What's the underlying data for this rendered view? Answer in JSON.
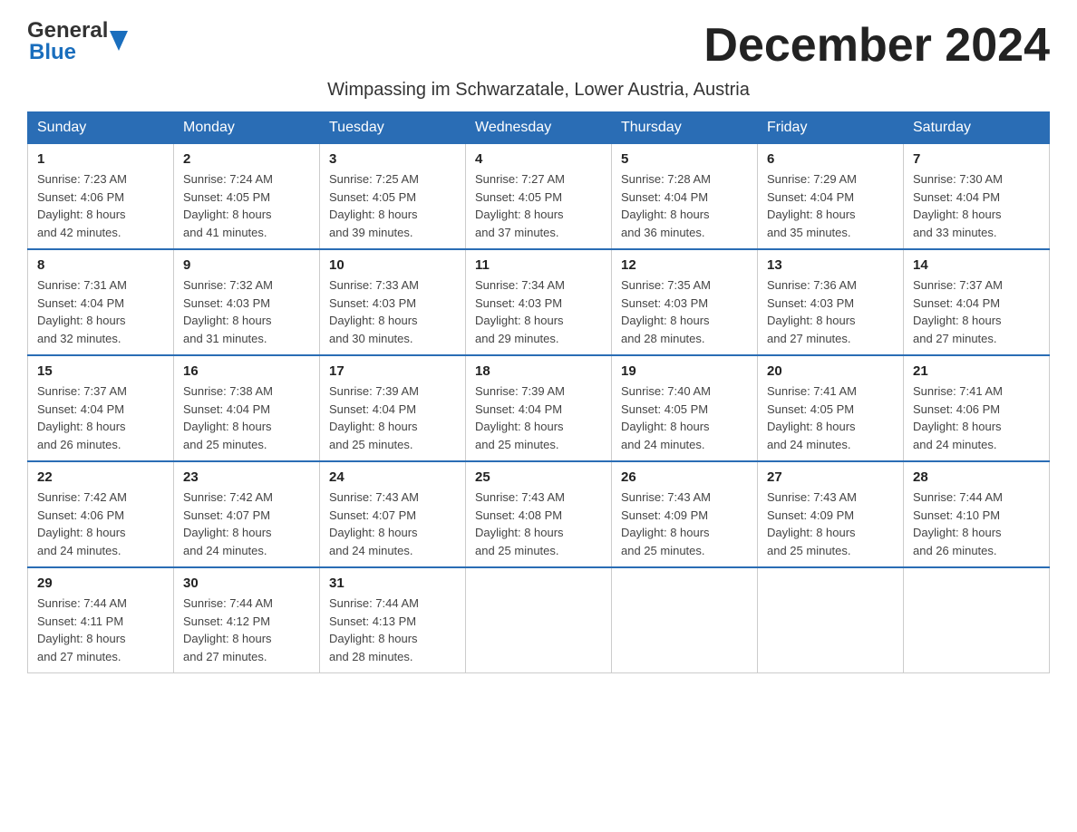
{
  "header": {
    "logo_general": "General",
    "logo_blue": "Blue",
    "month_title": "December 2024",
    "subtitle": "Wimpassing im Schwarzatale, Lower Austria, Austria"
  },
  "days_of_week": [
    "Sunday",
    "Monday",
    "Tuesday",
    "Wednesday",
    "Thursday",
    "Friday",
    "Saturday"
  ],
  "weeks": [
    [
      {
        "day": "1",
        "sunrise": "Sunrise: 7:23 AM",
        "sunset": "Sunset: 4:06 PM",
        "daylight": "Daylight: 8 hours",
        "daylight2": "and 42 minutes."
      },
      {
        "day": "2",
        "sunrise": "Sunrise: 7:24 AM",
        "sunset": "Sunset: 4:05 PM",
        "daylight": "Daylight: 8 hours",
        "daylight2": "and 41 minutes."
      },
      {
        "day": "3",
        "sunrise": "Sunrise: 7:25 AM",
        "sunset": "Sunset: 4:05 PM",
        "daylight": "Daylight: 8 hours",
        "daylight2": "and 39 minutes."
      },
      {
        "day": "4",
        "sunrise": "Sunrise: 7:27 AM",
        "sunset": "Sunset: 4:05 PM",
        "daylight": "Daylight: 8 hours",
        "daylight2": "and 37 minutes."
      },
      {
        "day": "5",
        "sunrise": "Sunrise: 7:28 AM",
        "sunset": "Sunset: 4:04 PM",
        "daylight": "Daylight: 8 hours",
        "daylight2": "and 36 minutes."
      },
      {
        "day": "6",
        "sunrise": "Sunrise: 7:29 AM",
        "sunset": "Sunset: 4:04 PM",
        "daylight": "Daylight: 8 hours",
        "daylight2": "and 35 minutes."
      },
      {
        "day": "7",
        "sunrise": "Sunrise: 7:30 AM",
        "sunset": "Sunset: 4:04 PM",
        "daylight": "Daylight: 8 hours",
        "daylight2": "and 33 minutes."
      }
    ],
    [
      {
        "day": "8",
        "sunrise": "Sunrise: 7:31 AM",
        "sunset": "Sunset: 4:04 PM",
        "daylight": "Daylight: 8 hours",
        "daylight2": "and 32 minutes."
      },
      {
        "day": "9",
        "sunrise": "Sunrise: 7:32 AM",
        "sunset": "Sunset: 4:03 PM",
        "daylight": "Daylight: 8 hours",
        "daylight2": "and 31 minutes."
      },
      {
        "day": "10",
        "sunrise": "Sunrise: 7:33 AM",
        "sunset": "Sunset: 4:03 PM",
        "daylight": "Daylight: 8 hours",
        "daylight2": "and 30 minutes."
      },
      {
        "day": "11",
        "sunrise": "Sunrise: 7:34 AM",
        "sunset": "Sunset: 4:03 PM",
        "daylight": "Daylight: 8 hours",
        "daylight2": "and 29 minutes."
      },
      {
        "day": "12",
        "sunrise": "Sunrise: 7:35 AM",
        "sunset": "Sunset: 4:03 PM",
        "daylight": "Daylight: 8 hours",
        "daylight2": "and 28 minutes."
      },
      {
        "day": "13",
        "sunrise": "Sunrise: 7:36 AM",
        "sunset": "Sunset: 4:03 PM",
        "daylight": "Daylight: 8 hours",
        "daylight2": "and 27 minutes."
      },
      {
        "day": "14",
        "sunrise": "Sunrise: 7:37 AM",
        "sunset": "Sunset: 4:04 PM",
        "daylight": "Daylight: 8 hours",
        "daylight2": "and 27 minutes."
      }
    ],
    [
      {
        "day": "15",
        "sunrise": "Sunrise: 7:37 AM",
        "sunset": "Sunset: 4:04 PM",
        "daylight": "Daylight: 8 hours",
        "daylight2": "and 26 minutes."
      },
      {
        "day": "16",
        "sunrise": "Sunrise: 7:38 AM",
        "sunset": "Sunset: 4:04 PM",
        "daylight": "Daylight: 8 hours",
        "daylight2": "and 25 minutes."
      },
      {
        "day": "17",
        "sunrise": "Sunrise: 7:39 AM",
        "sunset": "Sunset: 4:04 PM",
        "daylight": "Daylight: 8 hours",
        "daylight2": "and 25 minutes."
      },
      {
        "day": "18",
        "sunrise": "Sunrise: 7:39 AM",
        "sunset": "Sunset: 4:04 PM",
        "daylight": "Daylight: 8 hours",
        "daylight2": "and 25 minutes."
      },
      {
        "day": "19",
        "sunrise": "Sunrise: 7:40 AM",
        "sunset": "Sunset: 4:05 PM",
        "daylight": "Daylight: 8 hours",
        "daylight2": "and 24 minutes."
      },
      {
        "day": "20",
        "sunrise": "Sunrise: 7:41 AM",
        "sunset": "Sunset: 4:05 PM",
        "daylight": "Daylight: 8 hours",
        "daylight2": "and 24 minutes."
      },
      {
        "day": "21",
        "sunrise": "Sunrise: 7:41 AM",
        "sunset": "Sunset: 4:06 PM",
        "daylight": "Daylight: 8 hours",
        "daylight2": "and 24 minutes."
      }
    ],
    [
      {
        "day": "22",
        "sunrise": "Sunrise: 7:42 AM",
        "sunset": "Sunset: 4:06 PM",
        "daylight": "Daylight: 8 hours",
        "daylight2": "and 24 minutes."
      },
      {
        "day": "23",
        "sunrise": "Sunrise: 7:42 AM",
        "sunset": "Sunset: 4:07 PM",
        "daylight": "Daylight: 8 hours",
        "daylight2": "and 24 minutes."
      },
      {
        "day": "24",
        "sunrise": "Sunrise: 7:43 AM",
        "sunset": "Sunset: 4:07 PM",
        "daylight": "Daylight: 8 hours",
        "daylight2": "and 24 minutes."
      },
      {
        "day": "25",
        "sunrise": "Sunrise: 7:43 AM",
        "sunset": "Sunset: 4:08 PM",
        "daylight": "Daylight: 8 hours",
        "daylight2": "and 25 minutes."
      },
      {
        "day": "26",
        "sunrise": "Sunrise: 7:43 AM",
        "sunset": "Sunset: 4:09 PM",
        "daylight": "Daylight: 8 hours",
        "daylight2": "and 25 minutes."
      },
      {
        "day": "27",
        "sunrise": "Sunrise: 7:43 AM",
        "sunset": "Sunset: 4:09 PM",
        "daylight": "Daylight: 8 hours",
        "daylight2": "and 25 minutes."
      },
      {
        "day": "28",
        "sunrise": "Sunrise: 7:44 AM",
        "sunset": "Sunset: 4:10 PM",
        "daylight": "Daylight: 8 hours",
        "daylight2": "and 26 minutes."
      }
    ],
    [
      {
        "day": "29",
        "sunrise": "Sunrise: 7:44 AM",
        "sunset": "Sunset: 4:11 PM",
        "daylight": "Daylight: 8 hours",
        "daylight2": "and 27 minutes."
      },
      {
        "day": "30",
        "sunrise": "Sunrise: 7:44 AM",
        "sunset": "Sunset: 4:12 PM",
        "daylight": "Daylight: 8 hours",
        "daylight2": "and 27 minutes."
      },
      {
        "day": "31",
        "sunrise": "Sunrise: 7:44 AM",
        "sunset": "Sunset: 4:13 PM",
        "daylight": "Daylight: 8 hours",
        "daylight2": "and 28 minutes."
      },
      null,
      null,
      null,
      null
    ]
  ]
}
